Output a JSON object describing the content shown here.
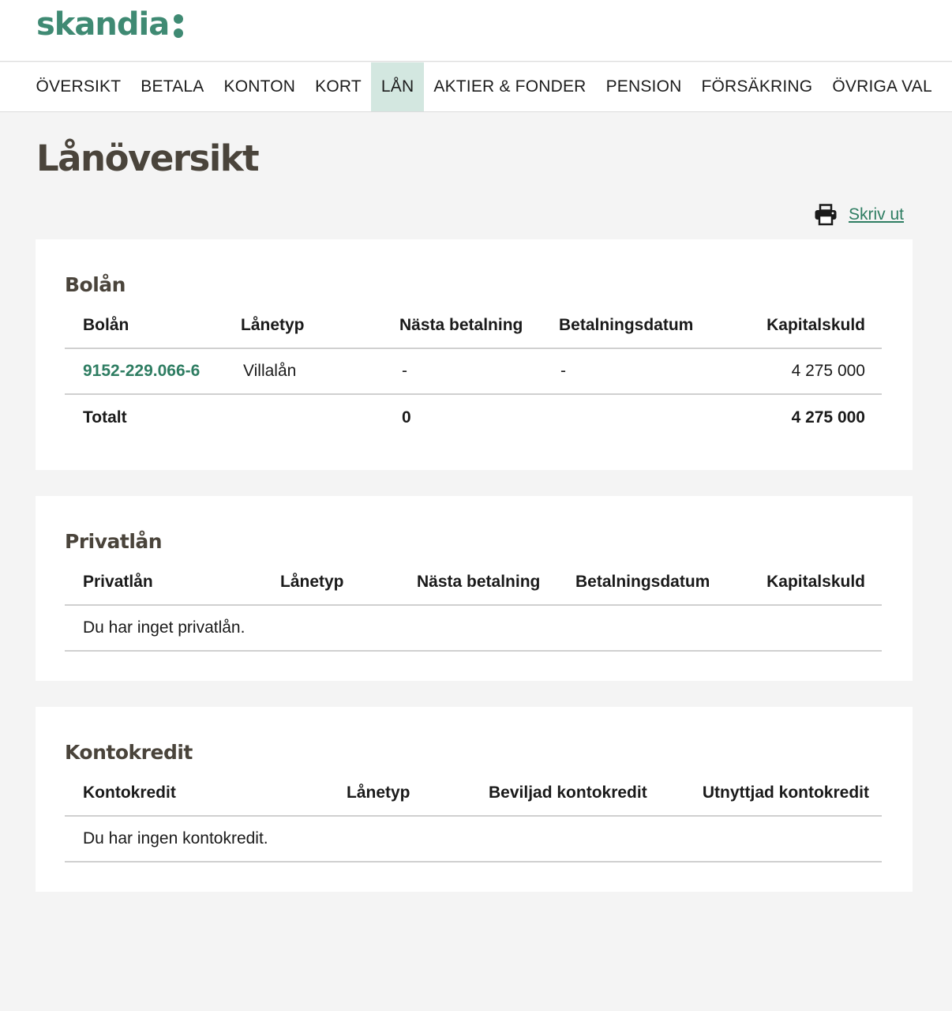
{
  "brand": {
    "name": "skandia",
    "color": "#3f8a73"
  },
  "nav": {
    "items": [
      {
        "label": "ÖVERSIKT"
      },
      {
        "label": "BETALA"
      },
      {
        "label": "KONTON"
      },
      {
        "label": "KORT"
      },
      {
        "label": "LÅN",
        "active": true
      },
      {
        "label": "AKTIER & FONDER"
      },
      {
        "label": "PENSION"
      },
      {
        "label": "FÖRSÄKRING"
      },
      {
        "label": "ÖVRIGA VAL"
      }
    ]
  },
  "page": {
    "title": "Lånöversikt",
    "print_label": "Skriv ut",
    "print_icon": "printer-icon"
  },
  "bolan": {
    "title": "Bolån",
    "headers": [
      "Bolån",
      "Lånetyp",
      "Nästa betalning",
      "Betalningsdatum",
      "Kapitalskuld"
    ],
    "rows": [
      {
        "account": "9152-229.066-6",
        "type": "Villalån",
        "next_payment": "-",
        "payment_date": "-",
        "capital_debt": "4 275 000"
      }
    ],
    "total": {
      "label": "Totalt",
      "next_payment": "0",
      "capital_debt": "4 275 000"
    }
  },
  "privatlan": {
    "title": "Privatlån",
    "headers": [
      "Privatlån",
      "Lånetyp",
      "Nästa betalning",
      "Betalningsdatum",
      "Kapitalskuld"
    ],
    "empty_message": "Du har inget privatlån."
  },
  "kontokredit": {
    "title": "Kontokredit",
    "headers": [
      "Kontokredit",
      "Lånetyp",
      "Beviljad kontokredit",
      "Utnyttjad kontokredit"
    ],
    "empty_message": "Du har ingen kontokredit."
  },
  "colors": {
    "accent": "#2e7d62",
    "active_tab": "#d3e7e0",
    "heading": "#4a443b",
    "background": "#f4f4f4"
  }
}
